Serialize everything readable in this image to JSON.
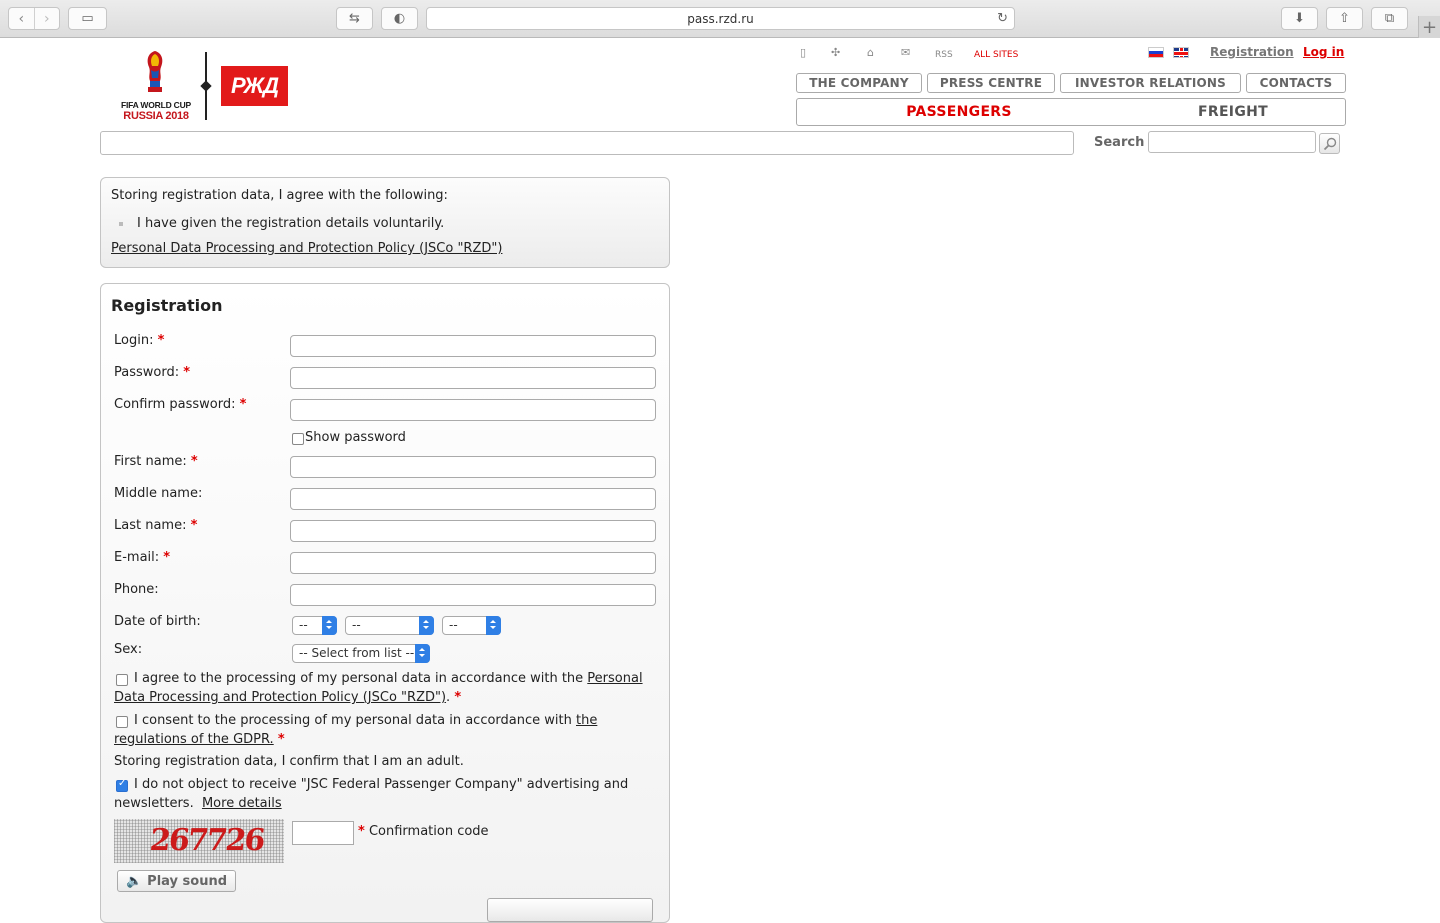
{
  "browser": {
    "url": "pass.rzd.ru"
  },
  "header": {
    "fifa_logo_line1": "FIFA WORLD CUP",
    "fifa_logo_line2": "RUSSIA 2018",
    "rzd_logo": "РЖД",
    "rss": "RSS",
    "all_sites": "ALL SITES",
    "registration": "Registration",
    "login": "Log in",
    "nav": [
      "THE COMPANY",
      "PRESS CENTRE",
      "INVESTOR RELATIONS",
      "CONTACTS"
    ],
    "sections": [
      "PASSENGERS",
      "FREIGHT"
    ],
    "search_label": "Search"
  },
  "notice": {
    "intro": "Storing registration data, I agree with the following:",
    "item": "I have given the registration details voluntarily.",
    "policy_link": "Personal Data Processing and Protection Policy (JSCo \"RZD\")"
  },
  "form": {
    "title": "Registration",
    "required_mark": "*",
    "fields": {
      "login": "Login:",
      "password": "Password:",
      "confirm_password": "Confirm password:",
      "show_password": "Show password",
      "first_name": "First name:",
      "middle_name": "Middle name:",
      "last_name": "Last name:",
      "email": "E-mail:",
      "phone": "Phone:",
      "dob": "Date of birth:",
      "sex": "Sex:"
    },
    "dob_placeholder": "--",
    "sex_placeholder": "-- Select from list --",
    "agree_text": "I agree to the processing of my personal data in accordance with the",
    "agree_link": "Personal Data Processing and Protection Policy (JSCo \"RZD\")",
    "consent_text": "I consent to the processing of my personal data in accordance with",
    "consent_link": "the regulations of the GDPR.",
    "adult_text": "Storing registration data, I confirm that I am an adult.",
    "ads_text": "I do not object to receive \"JSC Federal Passenger Company\" advertising and newsletters.",
    "ads_more": "More details",
    "ads_checked": true,
    "captcha_text": "267726",
    "confirmation_code": "Confirmation code",
    "play_sound": "Play sound"
  }
}
